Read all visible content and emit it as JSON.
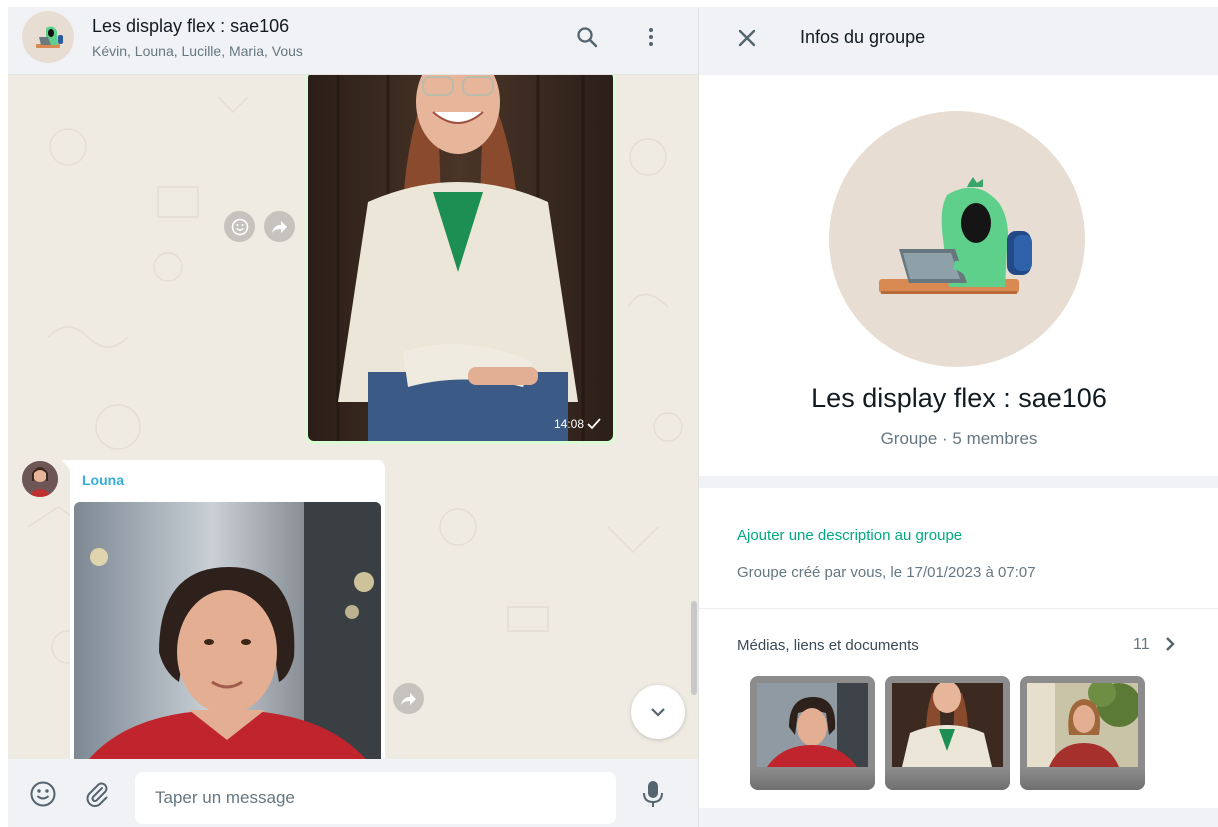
{
  "chat": {
    "title": "Les display flex : sae106",
    "participants": "Kévin, Louna, Lucille, Maria, Vous",
    "message_out": {
      "time": "14:08",
      "status": "sent-check-icon"
    },
    "message_in": {
      "sender": "Louna",
      "sender_color": "#35aede"
    },
    "composer": {
      "placeholder": "Taper un message"
    }
  },
  "group_info": {
    "header_title": "Infos du groupe",
    "name": "Les display flex : sae106",
    "meta": "Groupe · 5 membres",
    "add_description": "Ajouter une description au groupe",
    "created": "Groupe créé par vous, le 17/01/2023 à 07:07",
    "media": {
      "label": "Médias, liens et documents",
      "count": "11"
    }
  },
  "colors": {
    "accent": "#00a884",
    "panel_bg": "#f0f2f5",
    "chat_bg": "#efeae2",
    "bubble_out": "#d9fdd3",
    "sender_name": "#35aede"
  },
  "icons": [
    "search-icon",
    "menu-dots-icon",
    "close-icon",
    "emoji-icon",
    "attach-icon",
    "mic-icon",
    "forward-icon",
    "react-emoji-icon",
    "chevron-down-icon",
    "chevron-right-icon",
    "check-icon"
  ]
}
